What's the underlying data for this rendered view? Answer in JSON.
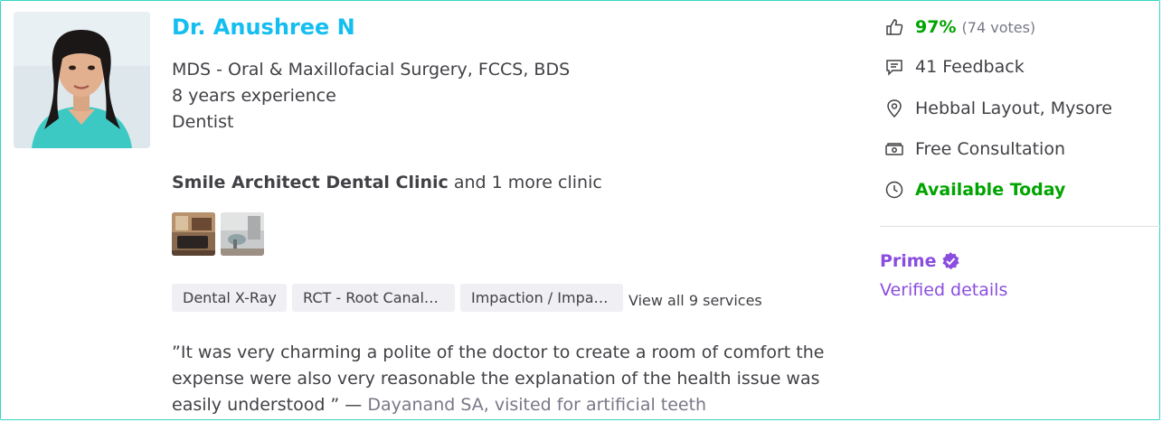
{
  "doctor": {
    "name": "Dr. Anushree N",
    "qualifications": "MDS - Oral & Maxillofacial Surgery, FCCS, BDS",
    "experience": "8 years experience",
    "specialty": "Dentist"
  },
  "clinic": {
    "name": "Smile Architect Dental Clinic",
    "more": " and 1 more clinic"
  },
  "services": {
    "chips": [
      "Dental X-Ray",
      "RCT - Root Canal…",
      "Impaction / Impa…"
    ],
    "view_all": "View all 9 services"
  },
  "review": {
    "text": "”It was very charming a polite of the doctor to create a room of comfort the expense were also very reasonable the explanation of the health issue was easily understood ”",
    "dash": " — ",
    "by": "Dayanand SA, visited for artificial teeth"
  },
  "stats": {
    "rating": "97%",
    "votes": "(74 votes)",
    "feedback": "41 Feedback",
    "location": "Hebbal Layout, Mysore",
    "consultation": "Free Consultation",
    "availability": "Available Today"
  },
  "prime": {
    "label": "Prime",
    "verified": "Verified details"
  },
  "colors": {
    "brand_blue": "#14bef0",
    "green": "#01a400",
    "purple": "#8a4de0",
    "border": "#35d6c7"
  }
}
